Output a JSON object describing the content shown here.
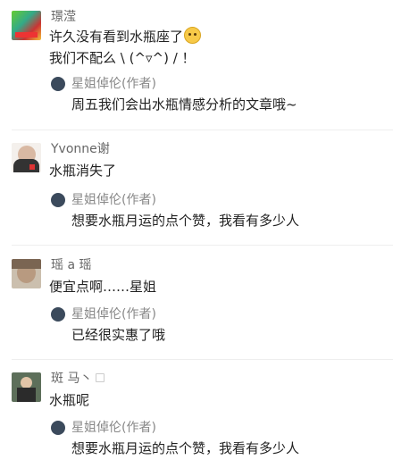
{
  "comments": [
    {
      "user": "璟滢",
      "lines": [
        "许久没有看到水瓶座了",
        "我们不配么 \\ (^▿^) / ！"
      ],
      "reply": {
        "user": "星姐倬伦(作者)",
        "text": "周五我们会出水瓶情感分析的文章哦~"
      }
    },
    {
      "user": "Yvonne谢",
      "lines": [
        "水瓶消失了"
      ],
      "reply": {
        "user": "星姐倬伦(作者)",
        "text": "想要水瓶月运的点个赞，我看有多少人"
      }
    },
    {
      "user": "瑶 a 瑶",
      "lines": [
        "便宜点啊……星姐"
      ],
      "reply": {
        "user": "星姐倬伦(作者)",
        "text": "已经很实惠了哦"
      }
    },
    {
      "user": "斑 马丶",
      "lines": [
        "水瓶呢"
      ],
      "reply": {
        "user": "星姐倬伦(作者)",
        "text": "想要水瓶月运的点个赞，我看有多少人"
      }
    }
  ],
  "icons": {
    "emoji": "worried-face-emoji",
    "author_avatar": "author-avatar"
  }
}
